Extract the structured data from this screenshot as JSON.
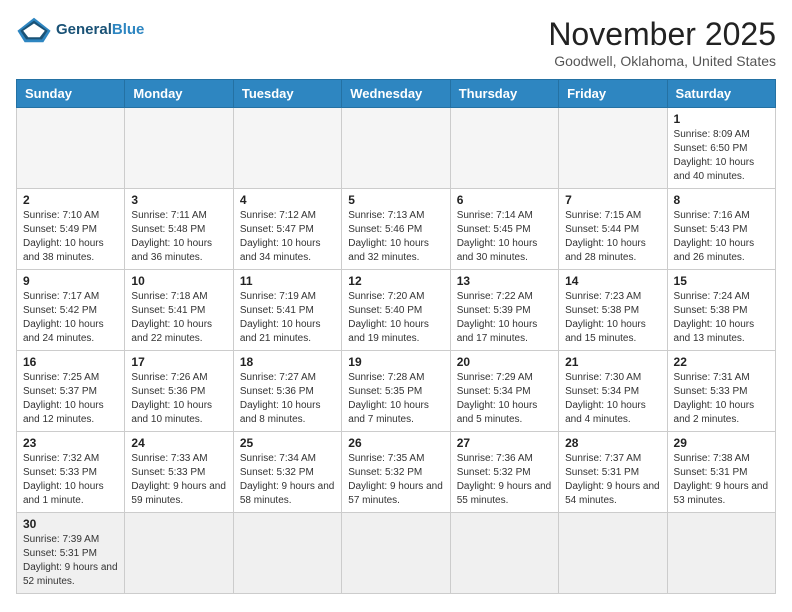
{
  "header": {
    "logo_text_general": "General",
    "logo_text_blue": "Blue",
    "month_title": "November 2025",
    "location": "Goodwell, Oklahoma, United States"
  },
  "weekdays": [
    "Sunday",
    "Monday",
    "Tuesday",
    "Wednesday",
    "Thursday",
    "Friday",
    "Saturday"
  ],
  "weeks": [
    [
      {
        "day": "",
        "info": ""
      },
      {
        "day": "",
        "info": ""
      },
      {
        "day": "",
        "info": ""
      },
      {
        "day": "",
        "info": ""
      },
      {
        "day": "",
        "info": ""
      },
      {
        "day": "",
        "info": ""
      },
      {
        "day": "1",
        "info": "Sunrise: 8:09 AM\nSunset: 6:50 PM\nDaylight: 10 hours and 40 minutes."
      }
    ],
    [
      {
        "day": "2",
        "info": "Sunrise: 7:10 AM\nSunset: 5:49 PM\nDaylight: 10 hours and 38 minutes."
      },
      {
        "day": "3",
        "info": "Sunrise: 7:11 AM\nSunset: 5:48 PM\nDaylight: 10 hours and 36 minutes."
      },
      {
        "day": "4",
        "info": "Sunrise: 7:12 AM\nSunset: 5:47 PM\nDaylight: 10 hours and 34 minutes."
      },
      {
        "day": "5",
        "info": "Sunrise: 7:13 AM\nSunset: 5:46 PM\nDaylight: 10 hours and 32 minutes."
      },
      {
        "day": "6",
        "info": "Sunrise: 7:14 AM\nSunset: 5:45 PM\nDaylight: 10 hours and 30 minutes."
      },
      {
        "day": "7",
        "info": "Sunrise: 7:15 AM\nSunset: 5:44 PM\nDaylight: 10 hours and 28 minutes."
      },
      {
        "day": "8",
        "info": "Sunrise: 7:16 AM\nSunset: 5:43 PM\nDaylight: 10 hours and 26 minutes."
      }
    ],
    [
      {
        "day": "9",
        "info": "Sunrise: 7:17 AM\nSunset: 5:42 PM\nDaylight: 10 hours and 24 minutes."
      },
      {
        "day": "10",
        "info": "Sunrise: 7:18 AM\nSunset: 5:41 PM\nDaylight: 10 hours and 22 minutes."
      },
      {
        "day": "11",
        "info": "Sunrise: 7:19 AM\nSunset: 5:41 PM\nDaylight: 10 hours and 21 minutes."
      },
      {
        "day": "12",
        "info": "Sunrise: 7:20 AM\nSunset: 5:40 PM\nDaylight: 10 hours and 19 minutes."
      },
      {
        "day": "13",
        "info": "Sunrise: 7:22 AM\nSunset: 5:39 PM\nDaylight: 10 hours and 17 minutes."
      },
      {
        "day": "14",
        "info": "Sunrise: 7:23 AM\nSunset: 5:38 PM\nDaylight: 10 hours and 15 minutes."
      },
      {
        "day": "15",
        "info": "Sunrise: 7:24 AM\nSunset: 5:38 PM\nDaylight: 10 hours and 13 minutes."
      }
    ],
    [
      {
        "day": "16",
        "info": "Sunrise: 7:25 AM\nSunset: 5:37 PM\nDaylight: 10 hours and 12 minutes."
      },
      {
        "day": "17",
        "info": "Sunrise: 7:26 AM\nSunset: 5:36 PM\nDaylight: 10 hours and 10 minutes."
      },
      {
        "day": "18",
        "info": "Sunrise: 7:27 AM\nSunset: 5:36 PM\nDaylight: 10 hours and 8 minutes."
      },
      {
        "day": "19",
        "info": "Sunrise: 7:28 AM\nSunset: 5:35 PM\nDaylight: 10 hours and 7 minutes."
      },
      {
        "day": "20",
        "info": "Sunrise: 7:29 AM\nSunset: 5:34 PM\nDaylight: 10 hours and 5 minutes."
      },
      {
        "day": "21",
        "info": "Sunrise: 7:30 AM\nSunset: 5:34 PM\nDaylight: 10 hours and 4 minutes."
      },
      {
        "day": "22",
        "info": "Sunrise: 7:31 AM\nSunset: 5:33 PM\nDaylight: 10 hours and 2 minutes."
      }
    ],
    [
      {
        "day": "23",
        "info": "Sunrise: 7:32 AM\nSunset: 5:33 PM\nDaylight: 10 hours and 1 minute."
      },
      {
        "day": "24",
        "info": "Sunrise: 7:33 AM\nSunset: 5:33 PM\nDaylight: 9 hours and 59 minutes."
      },
      {
        "day": "25",
        "info": "Sunrise: 7:34 AM\nSunset: 5:32 PM\nDaylight: 9 hours and 58 minutes."
      },
      {
        "day": "26",
        "info": "Sunrise: 7:35 AM\nSunset: 5:32 PM\nDaylight: 9 hours and 57 minutes."
      },
      {
        "day": "27",
        "info": "Sunrise: 7:36 AM\nSunset: 5:32 PM\nDaylight: 9 hours and 55 minutes."
      },
      {
        "day": "28",
        "info": "Sunrise: 7:37 AM\nSunset: 5:31 PM\nDaylight: 9 hours and 54 minutes."
      },
      {
        "day": "29",
        "info": "Sunrise: 7:38 AM\nSunset: 5:31 PM\nDaylight: 9 hours and 53 minutes."
      }
    ],
    [
      {
        "day": "30",
        "info": "Sunrise: 7:39 AM\nSunset: 5:31 PM\nDaylight: 9 hours and 52 minutes."
      },
      {
        "day": "",
        "info": ""
      },
      {
        "day": "",
        "info": ""
      },
      {
        "day": "",
        "info": ""
      },
      {
        "day": "",
        "info": ""
      },
      {
        "day": "",
        "info": ""
      },
      {
        "day": "",
        "info": ""
      }
    ]
  ]
}
